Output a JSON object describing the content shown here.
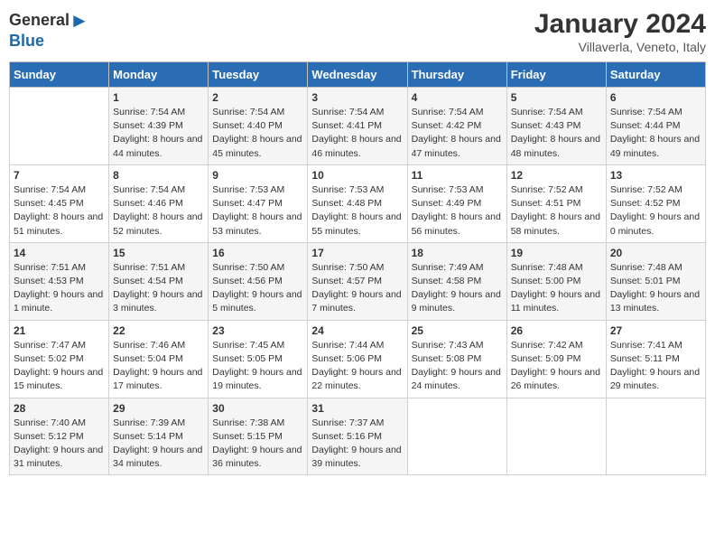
{
  "logo": {
    "general": "General",
    "blue": "Blue"
  },
  "title": "January 2024",
  "location": "Villaverla, Veneto, Italy",
  "headers": [
    "Sunday",
    "Monday",
    "Tuesday",
    "Wednesday",
    "Thursday",
    "Friday",
    "Saturday"
  ],
  "weeks": [
    [
      {
        "day": "",
        "sunrise": "",
        "sunset": "",
        "daylight": ""
      },
      {
        "day": "1",
        "sunrise": "Sunrise: 7:54 AM",
        "sunset": "Sunset: 4:39 PM",
        "daylight": "Daylight: 8 hours and 44 minutes."
      },
      {
        "day": "2",
        "sunrise": "Sunrise: 7:54 AM",
        "sunset": "Sunset: 4:40 PM",
        "daylight": "Daylight: 8 hours and 45 minutes."
      },
      {
        "day": "3",
        "sunrise": "Sunrise: 7:54 AM",
        "sunset": "Sunset: 4:41 PM",
        "daylight": "Daylight: 8 hours and 46 minutes."
      },
      {
        "day": "4",
        "sunrise": "Sunrise: 7:54 AM",
        "sunset": "Sunset: 4:42 PM",
        "daylight": "Daylight: 8 hours and 47 minutes."
      },
      {
        "day": "5",
        "sunrise": "Sunrise: 7:54 AM",
        "sunset": "Sunset: 4:43 PM",
        "daylight": "Daylight: 8 hours and 48 minutes."
      },
      {
        "day": "6",
        "sunrise": "Sunrise: 7:54 AM",
        "sunset": "Sunset: 4:44 PM",
        "daylight": "Daylight: 8 hours and 49 minutes."
      }
    ],
    [
      {
        "day": "7",
        "sunrise": "Sunrise: 7:54 AM",
        "sunset": "Sunset: 4:45 PM",
        "daylight": "Daylight: 8 hours and 51 minutes."
      },
      {
        "day": "8",
        "sunrise": "Sunrise: 7:54 AM",
        "sunset": "Sunset: 4:46 PM",
        "daylight": "Daylight: 8 hours and 52 minutes."
      },
      {
        "day": "9",
        "sunrise": "Sunrise: 7:53 AM",
        "sunset": "Sunset: 4:47 PM",
        "daylight": "Daylight: 8 hours and 53 minutes."
      },
      {
        "day": "10",
        "sunrise": "Sunrise: 7:53 AM",
        "sunset": "Sunset: 4:48 PM",
        "daylight": "Daylight: 8 hours and 55 minutes."
      },
      {
        "day": "11",
        "sunrise": "Sunrise: 7:53 AM",
        "sunset": "Sunset: 4:49 PM",
        "daylight": "Daylight: 8 hours and 56 minutes."
      },
      {
        "day": "12",
        "sunrise": "Sunrise: 7:52 AM",
        "sunset": "Sunset: 4:51 PM",
        "daylight": "Daylight: 8 hours and 58 minutes."
      },
      {
        "day": "13",
        "sunrise": "Sunrise: 7:52 AM",
        "sunset": "Sunset: 4:52 PM",
        "daylight": "Daylight: 9 hours and 0 minutes."
      }
    ],
    [
      {
        "day": "14",
        "sunrise": "Sunrise: 7:51 AM",
        "sunset": "Sunset: 4:53 PM",
        "daylight": "Daylight: 9 hours and 1 minute."
      },
      {
        "day": "15",
        "sunrise": "Sunrise: 7:51 AM",
        "sunset": "Sunset: 4:54 PM",
        "daylight": "Daylight: 9 hours and 3 minutes."
      },
      {
        "day": "16",
        "sunrise": "Sunrise: 7:50 AM",
        "sunset": "Sunset: 4:56 PM",
        "daylight": "Daylight: 9 hours and 5 minutes."
      },
      {
        "day": "17",
        "sunrise": "Sunrise: 7:50 AM",
        "sunset": "Sunset: 4:57 PM",
        "daylight": "Daylight: 9 hours and 7 minutes."
      },
      {
        "day": "18",
        "sunrise": "Sunrise: 7:49 AM",
        "sunset": "Sunset: 4:58 PM",
        "daylight": "Daylight: 9 hours and 9 minutes."
      },
      {
        "day": "19",
        "sunrise": "Sunrise: 7:48 AM",
        "sunset": "Sunset: 5:00 PM",
        "daylight": "Daylight: 9 hours and 11 minutes."
      },
      {
        "day": "20",
        "sunrise": "Sunrise: 7:48 AM",
        "sunset": "Sunset: 5:01 PM",
        "daylight": "Daylight: 9 hours and 13 minutes."
      }
    ],
    [
      {
        "day": "21",
        "sunrise": "Sunrise: 7:47 AM",
        "sunset": "Sunset: 5:02 PM",
        "daylight": "Daylight: 9 hours and 15 minutes."
      },
      {
        "day": "22",
        "sunrise": "Sunrise: 7:46 AM",
        "sunset": "Sunset: 5:04 PM",
        "daylight": "Daylight: 9 hours and 17 minutes."
      },
      {
        "day": "23",
        "sunrise": "Sunrise: 7:45 AM",
        "sunset": "Sunset: 5:05 PM",
        "daylight": "Daylight: 9 hours and 19 minutes."
      },
      {
        "day": "24",
        "sunrise": "Sunrise: 7:44 AM",
        "sunset": "Sunset: 5:06 PM",
        "daylight": "Daylight: 9 hours and 22 minutes."
      },
      {
        "day": "25",
        "sunrise": "Sunrise: 7:43 AM",
        "sunset": "Sunset: 5:08 PM",
        "daylight": "Daylight: 9 hours and 24 minutes."
      },
      {
        "day": "26",
        "sunrise": "Sunrise: 7:42 AM",
        "sunset": "Sunset: 5:09 PM",
        "daylight": "Daylight: 9 hours and 26 minutes."
      },
      {
        "day": "27",
        "sunrise": "Sunrise: 7:41 AM",
        "sunset": "Sunset: 5:11 PM",
        "daylight": "Daylight: 9 hours and 29 minutes."
      }
    ],
    [
      {
        "day": "28",
        "sunrise": "Sunrise: 7:40 AM",
        "sunset": "Sunset: 5:12 PM",
        "daylight": "Daylight: 9 hours and 31 minutes."
      },
      {
        "day": "29",
        "sunrise": "Sunrise: 7:39 AM",
        "sunset": "Sunset: 5:14 PM",
        "daylight": "Daylight: 9 hours and 34 minutes."
      },
      {
        "day": "30",
        "sunrise": "Sunrise: 7:38 AM",
        "sunset": "Sunset: 5:15 PM",
        "daylight": "Daylight: 9 hours and 36 minutes."
      },
      {
        "day": "31",
        "sunrise": "Sunrise: 7:37 AM",
        "sunset": "Sunset: 5:16 PM",
        "daylight": "Daylight: 9 hours and 39 minutes."
      },
      {
        "day": "",
        "sunrise": "",
        "sunset": "",
        "daylight": ""
      },
      {
        "day": "",
        "sunrise": "",
        "sunset": "",
        "daylight": ""
      },
      {
        "day": "",
        "sunrise": "",
        "sunset": "",
        "daylight": ""
      }
    ]
  ]
}
